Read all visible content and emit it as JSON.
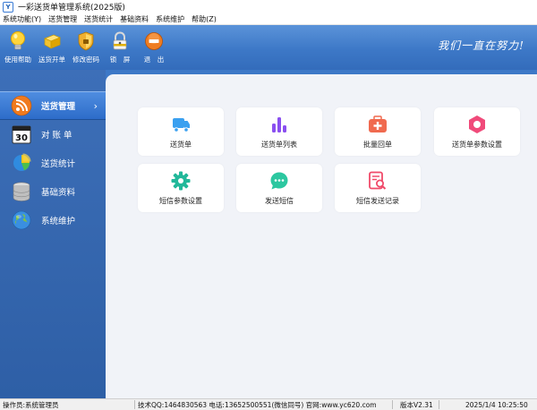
{
  "window": {
    "title": "一彩送货单管理系统(2025版)"
  },
  "menu": [
    "系统功能(Y)",
    "送货管理",
    "送货统计",
    "基础资料",
    "系统维护",
    "帮助(Z)"
  ],
  "toolbar": {
    "items": [
      {
        "label": "使用帮助",
        "icon": "lightbulb-icon"
      },
      {
        "label": "送货开单",
        "icon": "box-icon"
      },
      {
        "label": "修改密码",
        "icon": "shield-icon"
      },
      {
        "label": "锁　屏",
        "icon": "lock-icon"
      },
      {
        "label": "退　出",
        "icon": "exit-icon"
      }
    ],
    "slogan": "我们一直在努力!"
  },
  "sidebar": {
    "items": [
      {
        "label": "送货管理",
        "icon": "rss-icon",
        "active": true
      },
      {
        "label": "对 账 单",
        "icon": "calendar-icon",
        "active": false
      },
      {
        "label": "送货统计",
        "icon": "pie-chart-icon",
        "active": false
      },
      {
        "label": "基础资料",
        "icon": "database-icon",
        "active": false
      },
      {
        "label": "系统维护",
        "icon": "globe-icon",
        "active": false
      }
    ]
  },
  "cards": [
    {
      "label": "送货单",
      "icon": "truck-icon",
      "color": "#3aa0f0"
    },
    {
      "label": "送货单列表",
      "icon": "bar-chart-icon",
      "color": "#8a4ff0"
    },
    {
      "label": "批量回单",
      "icon": "medical-kit-icon",
      "color": "#f06a4f"
    },
    {
      "label": "送货单参数设置",
      "icon": "hexagon-icon",
      "color": "#f04a7a"
    },
    {
      "label": "短信参数设置",
      "icon": "gear-icon",
      "color": "#22b89a"
    },
    {
      "label": "发送短信",
      "icon": "chat-bubble-icon",
      "color": "#2cc7a0"
    },
    {
      "label": "短信发送记录",
      "icon": "document-search-icon",
      "color": "#f04a6a"
    }
  ],
  "statusbar": {
    "operator": "操作员:系统管理员",
    "support": "技术QQ:1464830563  电话:13652500551(微信同号) 官网:www.yc620.com",
    "version": "版本V2.31",
    "datetime": "2025/1/4 10:25:50"
  }
}
